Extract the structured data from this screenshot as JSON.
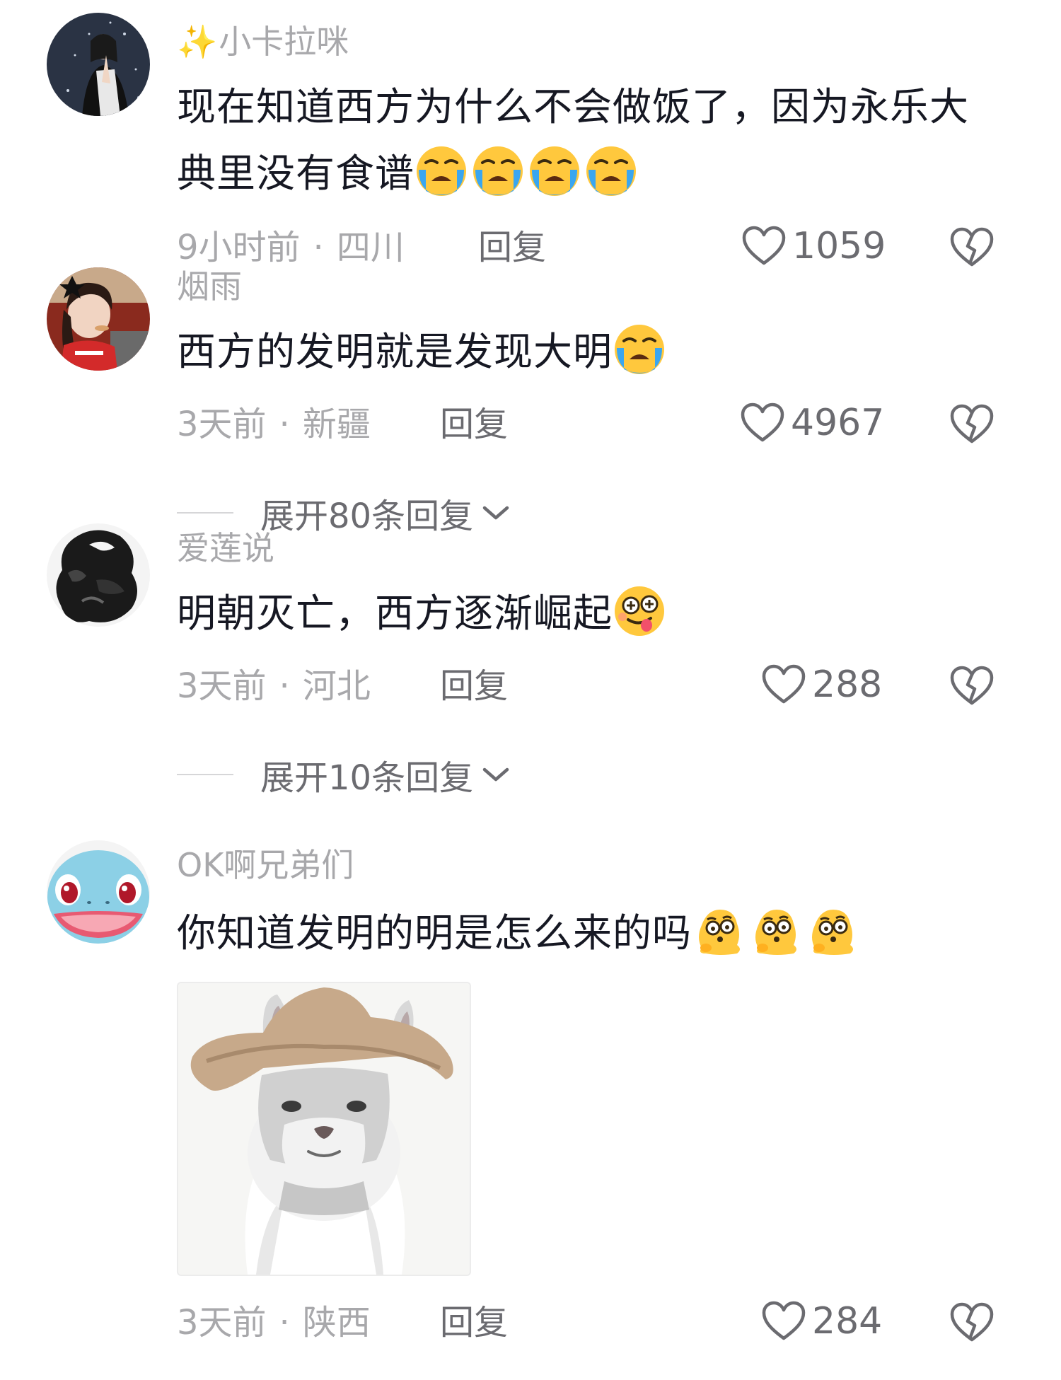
{
  "comments": [
    {
      "username_prefix": "✨",
      "username": "小卡拉咪",
      "text": "现在知道西方为什么不会做饭了，因为永乐大典里没有食谱",
      "emojis": [
        "crying-emoji",
        "crying-emoji",
        "crying-emoji",
        "crying-emoji"
      ],
      "time": "9小时前",
      "location": "四川",
      "reply_label": "回复",
      "likes": "1059"
    },
    {
      "username": "烟雨",
      "text": "西方的发明就是发现大明",
      "emojis": [
        "crying-emoji"
      ],
      "time": "3天前",
      "location": "新疆",
      "reply_label": "回复",
      "likes": "4967",
      "expand_label": "展开80条回复"
    },
    {
      "username": "爱莲说",
      "text": "明朝灭亡，西方逐渐崛起",
      "emojis": [
        "dizzy-tongue-emoji"
      ],
      "time": "3天前",
      "location": "河北",
      "reply_label": "回复",
      "likes": "288",
      "expand_label": "展开10条回复"
    },
    {
      "username": "OK啊兄弟们",
      "text": "你知道发明的明是怎么来的吗",
      "emojis": [
        "thinking-blob-emoji",
        "thinking-blob-emoji",
        "thinking-blob-emoji"
      ],
      "sticker": "cat-with-hat-sticker",
      "time": "3天前",
      "location": "陕西",
      "reply_label": "回复",
      "likes": "284"
    }
  ],
  "separator": "·",
  "icons": {
    "like": "heart-outline-icon",
    "dislike": "broken-heart-icon",
    "expand": "chevron-down-icon"
  },
  "colors": {
    "text": "#161823",
    "secondary": "#a8a8ab",
    "action": "#6b6b70",
    "emoji_yellow": "#ffc83d",
    "tear_blue": "#3aa6f0"
  }
}
